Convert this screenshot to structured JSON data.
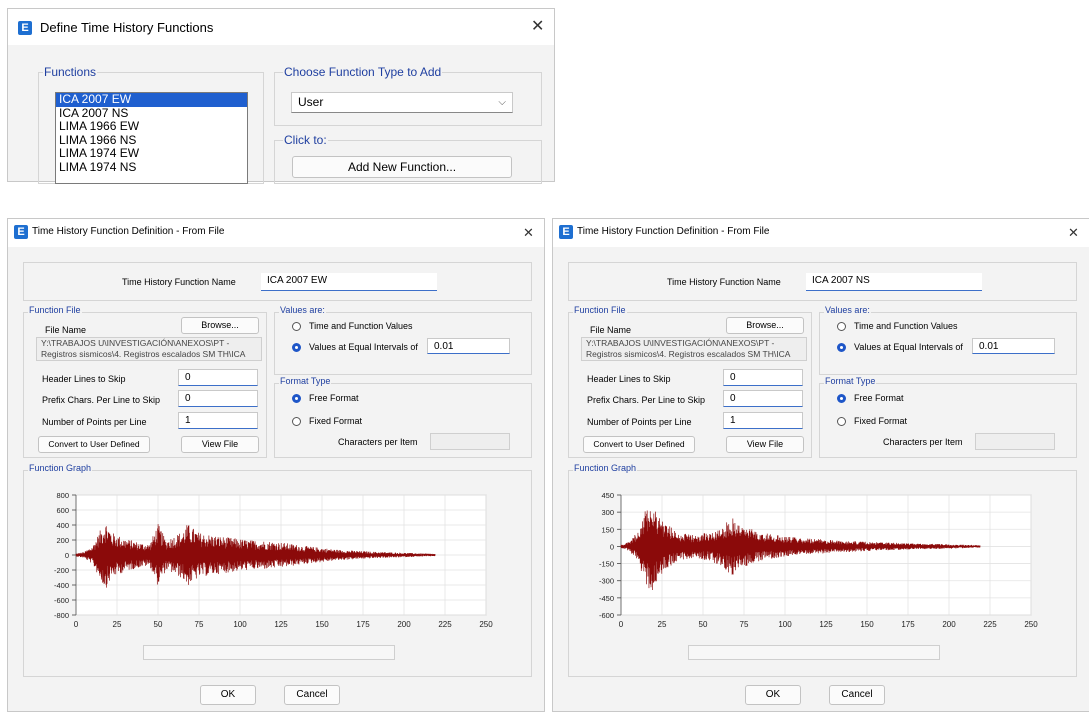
{
  "top_dialog": {
    "title": "Define Time History Functions",
    "functions_label": "Functions",
    "functions": [
      "ICA 2007 EW",
      "ICA 2007 NS",
      "LIMA 1966 EW",
      "LIMA 1966 NS",
      "LIMA 1974 EW",
      "LIMA 1974 NS"
    ],
    "selected_index": 0,
    "choose_label": "Choose  Function Type to Add",
    "function_type": "User",
    "click_label": "Click to:",
    "add_button": "Add New Function..."
  },
  "dialogs": [
    {
      "title": "Time History Function Definition  - From File",
      "name_label": "Time History Function Name",
      "name_value": "ICA 2007 EW",
      "function_file_label": "Function File",
      "file_name_label": "File Name",
      "browse": "Browse...",
      "path_line1": "Y:\\TRABAJOS U\\INVESTIGACIÓN\\ANEXOS\\PT -",
      "path_line2": "Registros sismicos\\4. Registros escalados SM TH\\ICA",
      "header_lines_label": "Header Lines to Skip",
      "header_lines": "0",
      "prefix_label": "Prefix Chars. Per Line to Skip",
      "prefix": "0",
      "points_label": "Number of Points per Line",
      "points": "1",
      "convert_button": "Convert to User Defined",
      "view_button": "View File",
      "values_label": "Values are:",
      "opt_time": "Time and Function Values",
      "opt_equal": "Values at Equal Intervals of",
      "interval": "0.01",
      "format_label": "Format Type",
      "opt_free": "Free Format",
      "opt_fixed": "Fixed Format",
      "chars_label": "Characters per Item",
      "graph_label": "Function Graph",
      "ok": "OK",
      "cancel": "Cancel",
      "chart_data": {
        "type": "line",
        "x_ticks": [
          "0",
          "25",
          "50",
          "75",
          "100",
          "125",
          "150",
          "175",
          "200",
          "225",
          "250"
        ],
        "y_ticks": [
          "800",
          "600",
          "400",
          "200",
          "0",
          "-200",
          "-400",
          "-600",
          "-800"
        ],
        "xlim": [
          0,
          250
        ],
        "ylim": [
          -800,
          800
        ],
        "grid": true,
        "line_color": "#8b0a0a",
        "x_end": 219,
        "peak_max": 450,
        "peak_min": -560,
        "envelope": [
          [
            0,
            20
          ],
          [
            5,
            40
          ],
          [
            10,
            120
          ],
          [
            15,
            340
          ],
          [
            18,
            460
          ],
          [
            22,
            300
          ],
          [
            30,
            220
          ],
          [
            40,
            160
          ],
          [
            45,
            150
          ],
          [
            50,
            420
          ],
          [
            55,
            200
          ],
          [
            60,
            260
          ],
          [
            65,
            320
          ],
          [
            68,
            420
          ],
          [
            75,
            300
          ],
          [
            85,
            260
          ],
          [
            95,
            230
          ],
          [
            105,
            200
          ],
          [
            115,
            190
          ],
          [
            125,
            170
          ],
          [
            140,
            120
          ],
          [
            160,
            70
          ],
          [
            180,
            45
          ],
          [
            200,
            30
          ],
          [
            219,
            15
          ]
        ]
      }
    },
    {
      "title": "Time History Function Definition  - From File",
      "name_label": "Time History Function Name",
      "name_value": "ICA 2007 NS",
      "function_file_label": "Function File",
      "file_name_label": "File Name",
      "browse": "Browse...",
      "path_line1": "Y:\\TRABAJOS U\\INVESTIGACIÓN\\ANEXOS\\PT -",
      "path_line2": "Registros sismicos\\4. Registros escalados SM TH\\ICA",
      "header_lines_label": "Header Lines to Skip",
      "header_lines": "0",
      "prefix_label": "Prefix Chars. Per Line to Skip",
      "prefix": "0",
      "points_label": "Number of Points per Line",
      "points": "1",
      "convert_button": "Convert to User Defined",
      "view_button": "View File",
      "values_label": "Values are:",
      "opt_time": "Time and Function Values",
      "opt_equal": "Values at Equal Intervals of",
      "interval": "0.01",
      "format_label": "Format Type",
      "opt_free": "Free Format",
      "opt_fixed": "Fixed Format",
      "chars_label": "Characters per Item",
      "graph_label": "Function Graph",
      "ok": "OK",
      "cancel": "Cancel",
      "chart_data": {
        "type": "line",
        "x_ticks": [
          "0",
          "25",
          "50",
          "75",
          "100",
          "125",
          "150",
          "175",
          "200",
          "225",
          "250"
        ],
        "y_ticks": [
          "450",
          "300",
          "150",
          "0",
          "-150",
          "-300",
          "-450",
          "-600"
        ],
        "xlim": [
          0,
          250
        ],
        "ylim": [
          -600,
          450
        ],
        "grid": true,
        "line_color": "#8b0a0a",
        "x_end": 219,
        "peak_max": 410,
        "peak_min": -480,
        "envelope": [
          [
            0,
            15
          ],
          [
            5,
            40
          ],
          [
            10,
            130
          ],
          [
            15,
            320
          ],
          [
            18,
            420
          ],
          [
            22,
            300
          ],
          [
            28,
            200
          ],
          [
            35,
            120
          ],
          [
            45,
            100
          ],
          [
            55,
            130
          ],
          [
            62,
            180
          ],
          [
            68,
            260
          ],
          [
            72,
            200
          ],
          [
            80,
            150
          ],
          [
            90,
            110
          ],
          [
            100,
            90
          ],
          [
            115,
            70
          ],
          [
            130,
            55
          ],
          [
            150,
            40
          ],
          [
            175,
            28
          ],
          [
            200,
            20
          ],
          [
            219,
            10
          ]
        ]
      }
    }
  ]
}
